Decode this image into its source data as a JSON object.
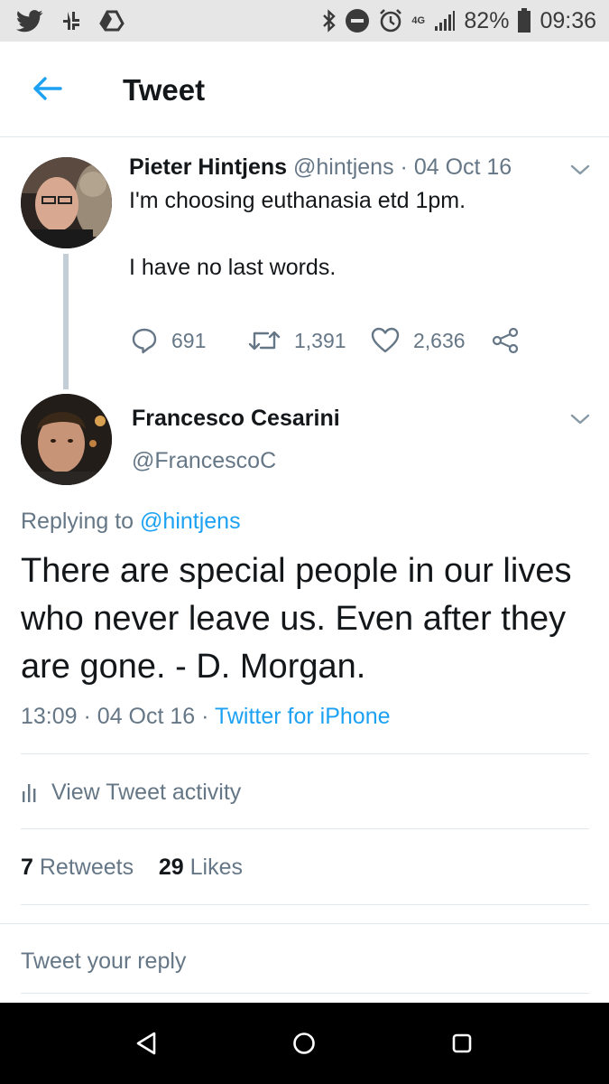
{
  "status_bar": {
    "network": "4G",
    "battery": "82%",
    "time": "09:36",
    "icons_left": [
      "twitter-icon",
      "network-transfer-icon",
      "google-drive-icon"
    ],
    "icons_right": [
      "bluetooth-icon",
      "do-not-disturb-icon",
      "alarm-icon",
      "signal-icon",
      "battery-icon"
    ]
  },
  "header": {
    "title": "Tweet",
    "back_icon": "arrow-left-icon"
  },
  "parent_tweet": {
    "name": "Pieter Hintjens",
    "handle": "@hintjens",
    "separator": "·",
    "date": "04 Oct 16",
    "line1": "I'm choosing euthanasia etd 1pm.",
    "line2": "I have no last words.",
    "replies": "691",
    "retweets": "1,391",
    "likes": "2,636"
  },
  "main_tweet": {
    "name": "Francesco Cesarini",
    "handle": "@FrancescoC",
    "replying_prefix": "Replying to ",
    "replying_to": "@hintjens",
    "body": "There are special people in our lives who never leave us. Even after they are gone. - D. Morgan.",
    "time": "13:09",
    "separator": "·",
    "date": "04 Oct 16",
    "source": "Twitter for iPhone"
  },
  "activity": {
    "label": "View Tweet activity"
  },
  "stats": {
    "retweets_count": "7",
    "retweets_label": "Retweets",
    "likes_count": "29",
    "likes_label": "Likes"
  },
  "reply": {
    "placeholder": "Tweet your reply"
  },
  "colors": {
    "accent": "#1da1f2",
    "muted": "#657786",
    "text": "#14171a",
    "status_bar": "#e6e6e6",
    "nav_bar": "#000000"
  }
}
